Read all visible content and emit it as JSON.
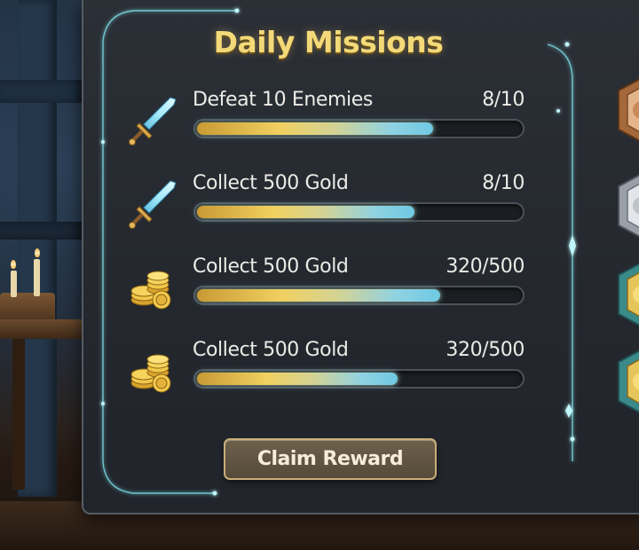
{
  "panel": {
    "title": "Daily Missions"
  },
  "missions": [
    {
      "icon": "sword-icon",
      "label": "Defeat 10 Enemies",
      "count": "8/10",
      "progress": 0.73
    },
    {
      "icon": "sword-icon",
      "label": "Collect 500 Gold",
      "count": "8/10",
      "progress": 0.67
    },
    {
      "icon": "gold-coins-icon",
      "label": "Collect 500 Gold",
      "count": "320/500",
      "progress": 0.75
    },
    {
      "icon": "gold-coins-icon",
      "label": "Collect 500 Gold",
      "count": "320/500",
      "progress": 0.62
    }
  ],
  "claim_button": {
    "label": "Claim Reward"
  },
  "rewards": [
    {
      "icon": "bronze-medal-icon",
      "tier": "bronze"
    },
    {
      "icon": "silver-medal-icon",
      "tier": "silver"
    },
    {
      "icon": "gold-medal-icon",
      "tier": "gold"
    },
    {
      "icon": "gold-medal-icon",
      "tier": "gold"
    }
  ],
  "colors": {
    "title": "#f3d978",
    "panel": "#2b2f36",
    "accent_glow": "#7fe3ee",
    "bar_gold": "#f0d060",
    "bar_blue": "#6fc9e3",
    "button_border": "#c8ad7a"
  }
}
